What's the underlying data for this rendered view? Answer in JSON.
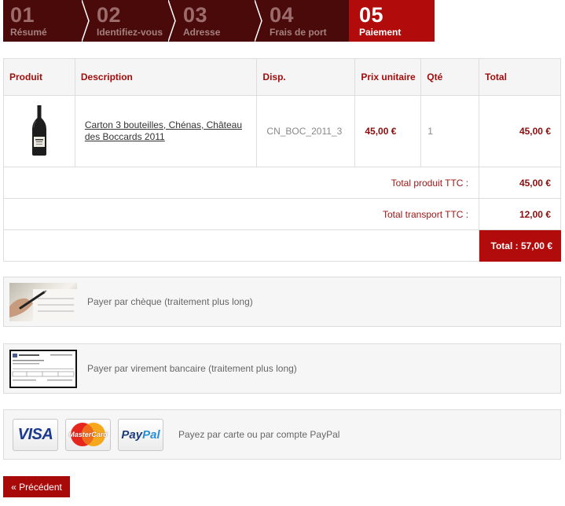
{
  "steps": [
    {
      "num": "01",
      "label": "Résumé"
    },
    {
      "num": "02",
      "label": "Identifiez-vous"
    },
    {
      "num": "03",
      "label": "Adresse"
    },
    {
      "num": "04",
      "label": "Frais de port"
    },
    {
      "num": "05",
      "label": "Paiement"
    }
  ],
  "cart": {
    "headers": {
      "product": "Produit",
      "description": "Description",
      "disp": "Disp.",
      "unit_price": "Prix unitaire",
      "qty": "Qté",
      "total": "Total"
    },
    "items": [
      {
        "description": "Carton 3 bouteilles, Chénas, Château des Boccards 2011",
        "disp": "CN_BOC_2011_3",
        "unit_price": "45,00 €",
        "qty": "1",
        "total": "45,00 €"
      }
    ],
    "subtotal_label": "Total produit TTC :",
    "subtotal_value": "45,00 €",
    "shipping_label": "Total transport TTC :",
    "shipping_value": "12,00 €",
    "grand_total": "Total : 57,00 €"
  },
  "payments": {
    "cheque": "Payer par chèque (traitement plus long)",
    "virement": "Payer par virement bancaire (traitement plus long)",
    "card": "Payez par carte ou par compte PayPal",
    "card_brands": {
      "visa": "VISA",
      "mastercard": "MasterCard",
      "paypal_pay": "Pay",
      "paypal_pal": "Pal"
    }
  },
  "back_button": "« Précédent"
}
